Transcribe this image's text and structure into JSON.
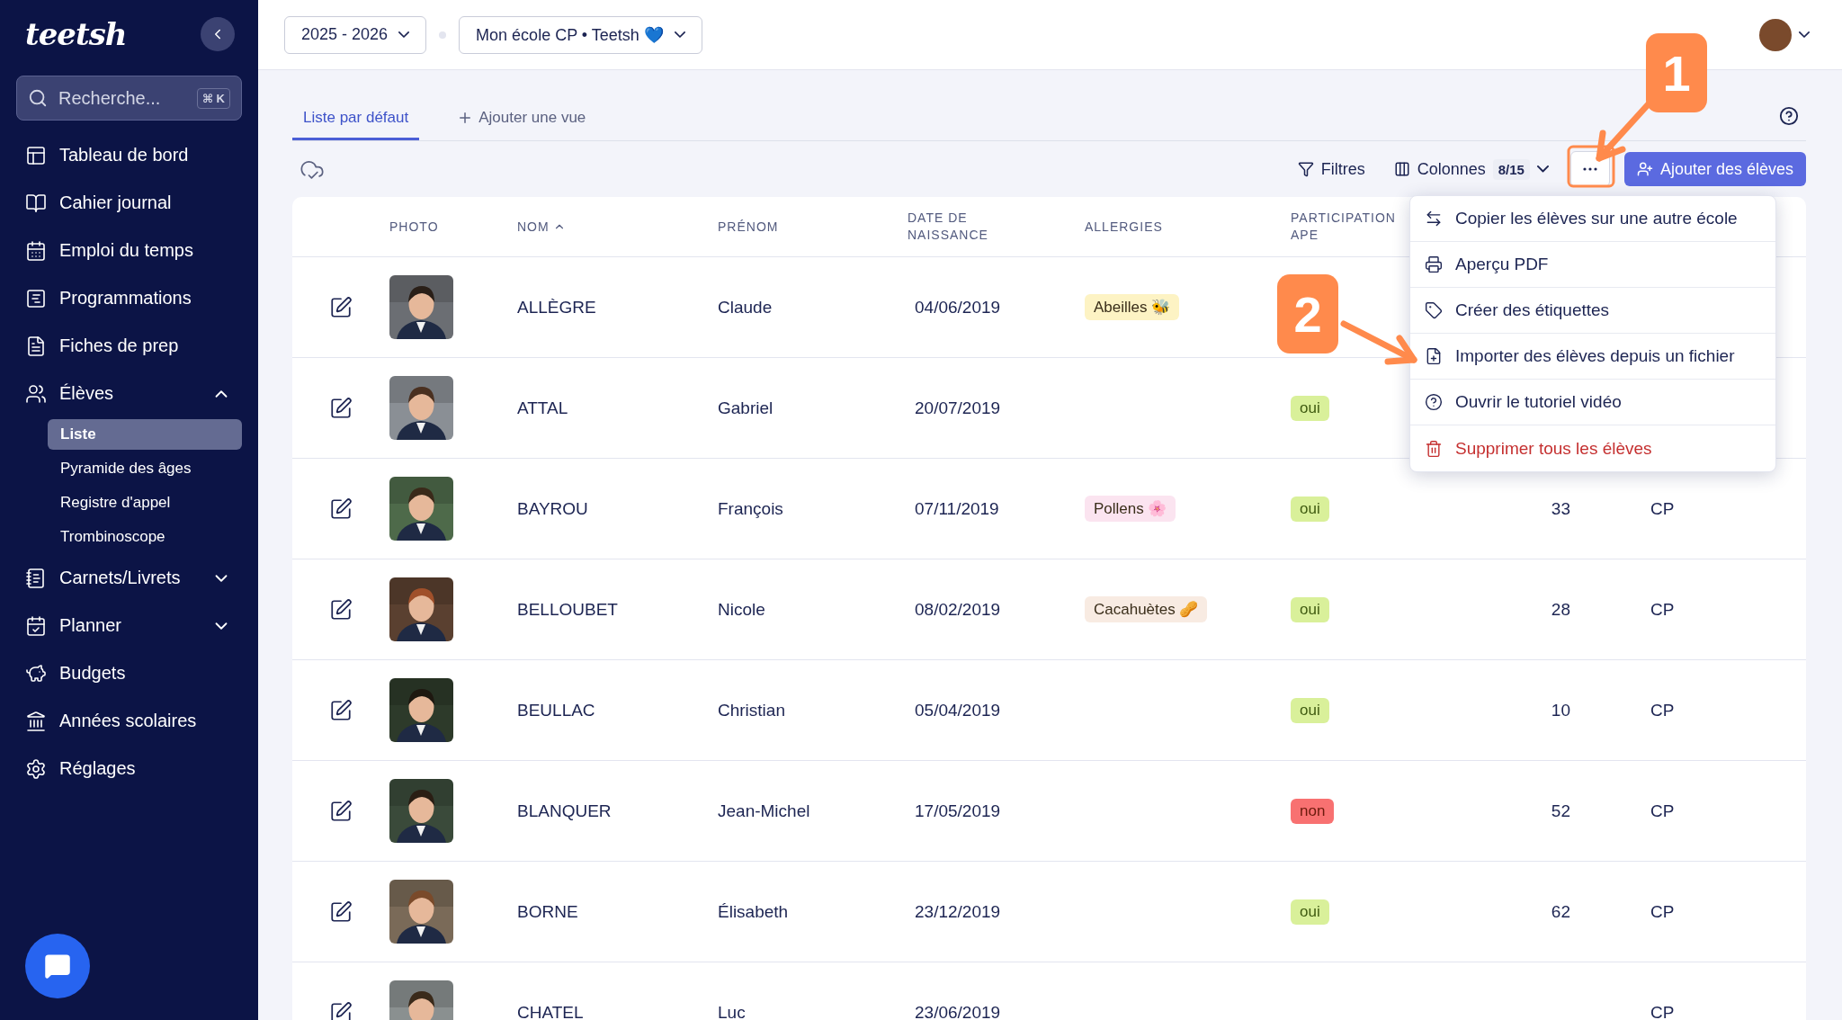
{
  "sidebar": {
    "logo": "teetsh",
    "search": {
      "placeholder": "Recherche...",
      "shortcut": "⌘ K"
    },
    "items": [
      {
        "label": "Tableau de bord"
      },
      {
        "label": "Cahier journal"
      },
      {
        "label": "Emploi du temps"
      },
      {
        "label": "Programmations"
      },
      {
        "label": "Fiches de prep"
      },
      {
        "label": "Élèves",
        "expanded": true,
        "children": [
          {
            "label": "Liste",
            "selected": true
          },
          {
            "label": "Pyramide des âges",
            "selected": false
          },
          {
            "label": "Registre d'appel",
            "selected": false
          },
          {
            "label": "Trombinoscope",
            "selected": false
          }
        ]
      },
      {
        "label": "Carnets/Livrets",
        "expanded": false
      },
      {
        "label": "Planner",
        "expanded": false
      },
      {
        "label": "Budgets"
      },
      {
        "label": "Années scolaires"
      },
      {
        "label": "Réglages"
      }
    ]
  },
  "topbar": {
    "year": "2025 - 2026",
    "school": "Mon école CP • Teetsh 💙"
  },
  "views": {
    "tabs": [
      {
        "label": "Liste par défaut",
        "selected": true
      }
    ],
    "add_view": "Ajouter une vue"
  },
  "toolbar": {
    "filters": "Filtres",
    "columns": "Colonnes",
    "columns_count": "8/15",
    "add_button": "Ajouter des élèves"
  },
  "table": {
    "columns": [
      {
        "label": "PHOTO"
      },
      {
        "label": "NOM",
        "sorted": true
      },
      {
        "label": "PRÉNOM"
      },
      {
        "label": "DATE DE NAISSANCE"
      },
      {
        "label": "ALLERGIES"
      },
      {
        "label": "PARTICIPATION APE"
      }
    ],
    "rows": [
      {
        "nom": "ALLÈGRE",
        "prenom": "Claude",
        "date": "04/06/2019",
        "allergy": {
          "label": "Abeilles 🐝",
          "color": "#fdf3c4"
        }
      },
      {
        "nom": "ATTAL",
        "prenom": "Gabriel",
        "date": "20/07/2019",
        "ape": "oui"
      },
      {
        "nom": "BAYROU",
        "prenom": "François",
        "date": "07/11/2019",
        "allergy": {
          "label": "Pollens 🌸",
          "color": "#fbe4f0"
        },
        "ape": "oui",
        "column_7": "33",
        "column_8": "CP"
      },
      {
        "nom": "BELLOUBET",
        "prenom": "Nicole",
        "date": "08/02/2019",
        "allergy": {
          "label": "Cacahuètes 🥜",
          "color": "#f8ebe2"
        },
        "ape": "oui",
        "column_7": "28",
        "column_8": "CP"
      },
      {
        "nom": "BEULLAC",
        "prenom": "Christian",
        "date": "05/04/2019",
        "ape": "oui",
        "column_7": "10",
        "column_8": "CP"
      },
      {
        "nom": "BLANQUER",
        "prenom": "Jean-Michel",
        "date": "17/05/2019",
        "ape": "non",
        "column_7": "52",
        "column_8": "CP"
      },
      {
        "nom": "BORNE",
        "prenom": "Élisabeth",
        "date": "23/12/2019",
        "ape": "oui",
        "column_7": "62",
        "column_8": "CP"
      },
      {
        "nom": "CHATEL",
        "prenom": "Luc",
        "date": "23/06/2019",
        "column_8": "CP"
      }
    ]
  },
  "menu": {
    "items": [
      {
        "label": "Copier les élèves sur une autre école",
        "danger": false
      },
      {
        "label": "Aperçu PDF",
        "danger": false
      },
      {
        "label": "Créer des étiquettes",
        "danger": false
      },
      {
        "label": "Importer des élèves depuis un fichier",
        "danger": false
      },
      {
        "label": "Ouvrir le tutoriel vidéo",
        "danger": false
      },
      {
        "label": "Supprimer tous les élèves",
        "danger": true
      }
    ]
  },
  "annotations": [
    {
      "label": "1"
    },
    {
      "label": "2"
    }
  ]
}
